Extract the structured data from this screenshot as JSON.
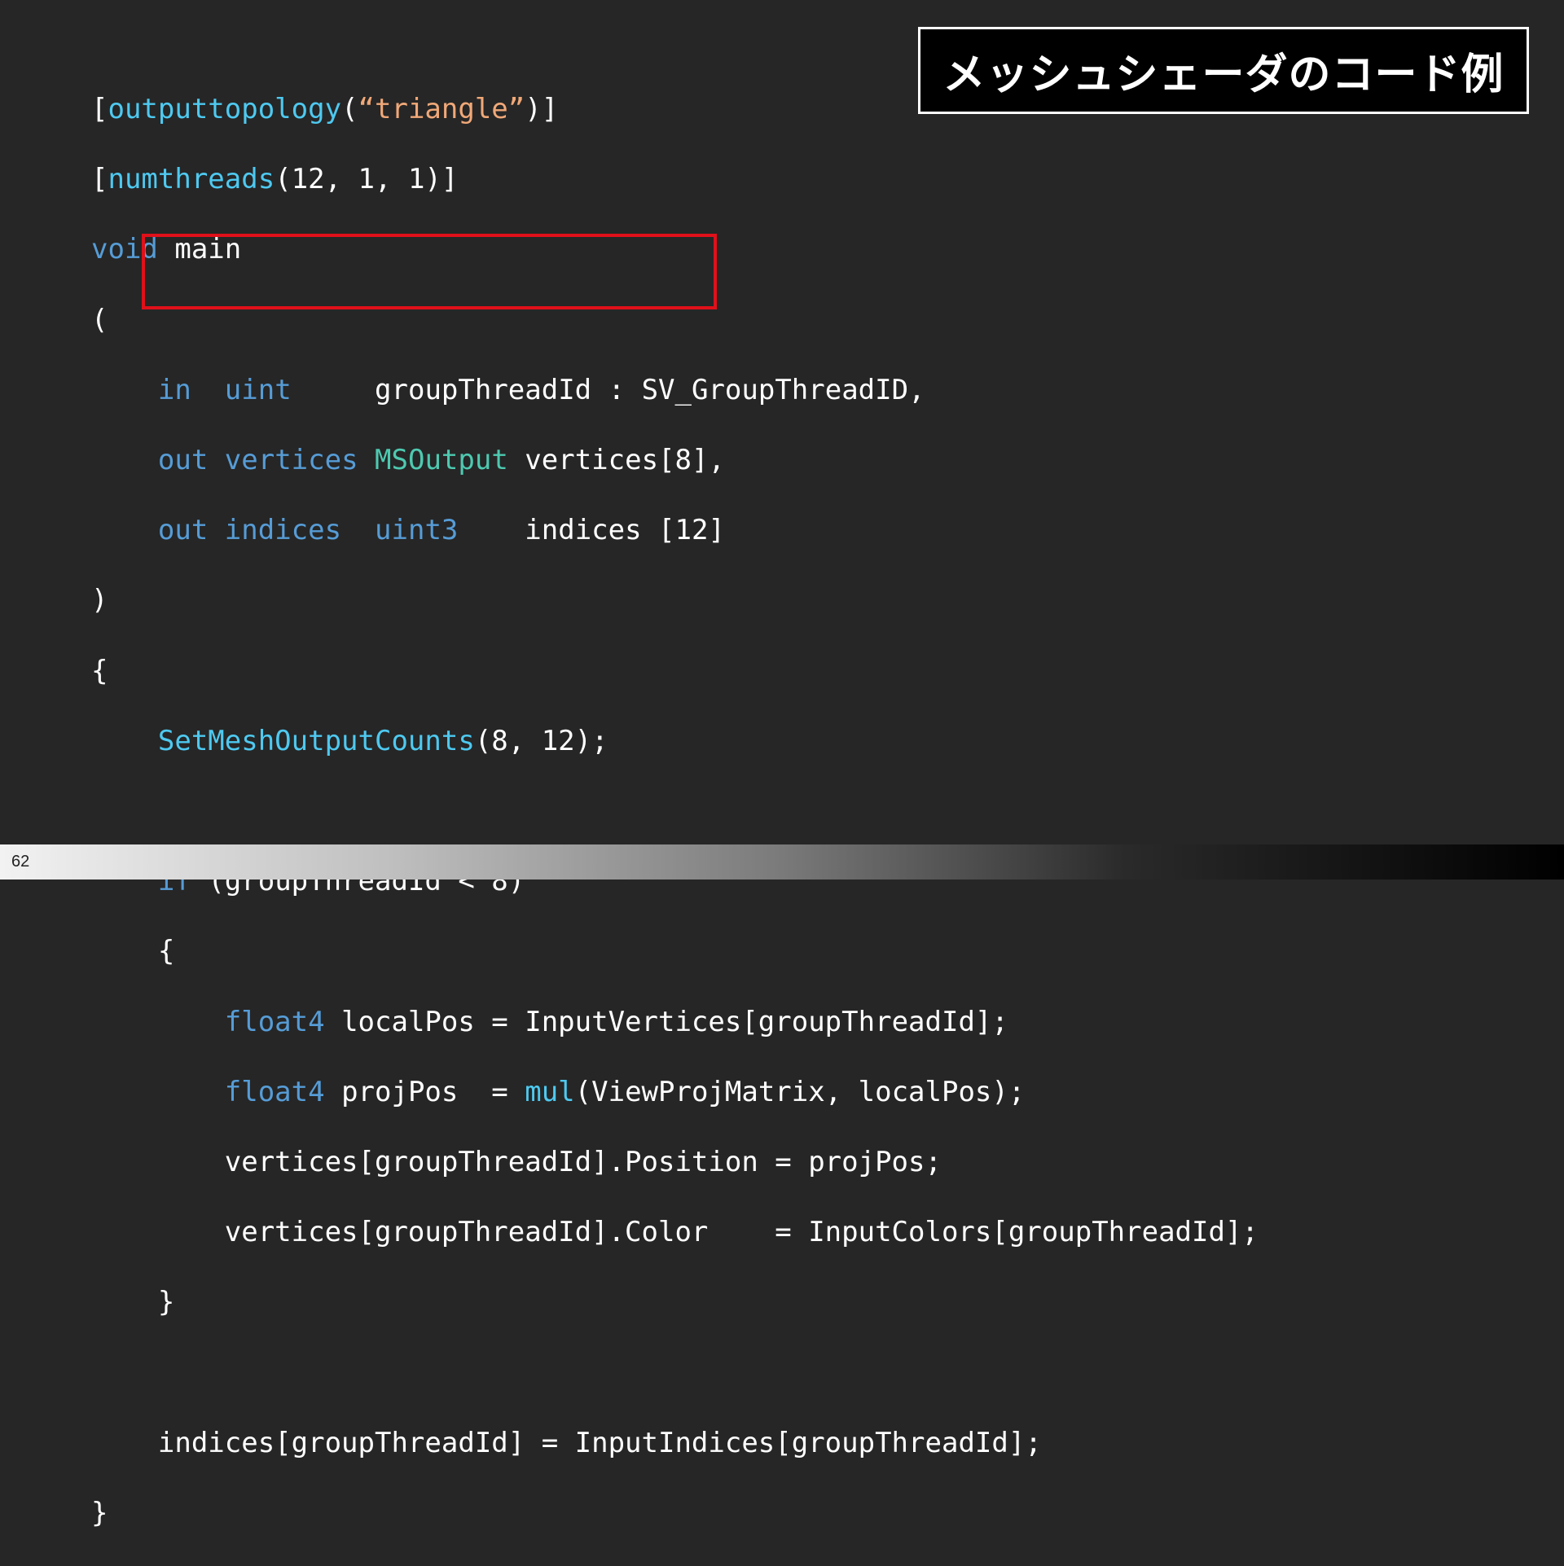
{
  "slide": {
    "title": "メッシュシェーダのコード例",
    "page_number": "62"
  },
  "code": {
    "l1_open": "[",
    "l1_attr": "outputtopology",
    "l1_paren": "(",
    "l1_str": "“triangle”",
    "l1_close": ")]",
    "l2_open": "[",
    "l2_attr": "numthreads",
    "l2_rest": "(12, 1, 1)]",
    "l3_kw": "void",
    "l3_rest": " main",
    "l4": "(",
    "l5_in": "in",
    "l5_uint": "uint",
    "l5_rest": "groupThreadId : SV_GroupThreadID,",
    "l6_out": "out",
    "l6_vertices_kw": "vertices",
    "l6_type": "MSOutput",
    "l6_rest": "vertices[8],",
    "l7_out": "out",
    "l7_indices_kw": "indices",
    "l7_type": "uint3",
    "l7_rest": "indices [12]",
    "l8": ")",
    "l9": "{",
    "l10_fn": "SetMeshOutputCounts",
    "l10_rest": "(8, 12);",
    "l12_kw": "if",
    "l12_rest": " (groupThreadId < 8)",
    "l13": "{",
    "l14_type": "float4",
    "l14_rest": " localPos = InputVertices[groupThreadId];",
    "l15_type": "float4",
    "l15_mid": " projPos  = ",
    "l15_fn": "mul",
    "l15_rest": "(ViewProjMatrix, localPos);",
    "l16": "vertices[groupThreadId].Position = projPos;",
    "l17": "vertices[groupThreadId].Color    = InputColors[groupThreadId];",
    "l18": "}",
    "l20": "indices[groupThreadId] = InputIndices[groupThreadId];",
    "l21": "}"
  },
  "colors": {
    "background": "#262626",
    "keyword": "#569cd6",
    "function": "#4ec9f0",
    "type": "#4ec9b0",
    "string": "#f0a878",
    "highlight_border": "#e0101a"
  }
}
